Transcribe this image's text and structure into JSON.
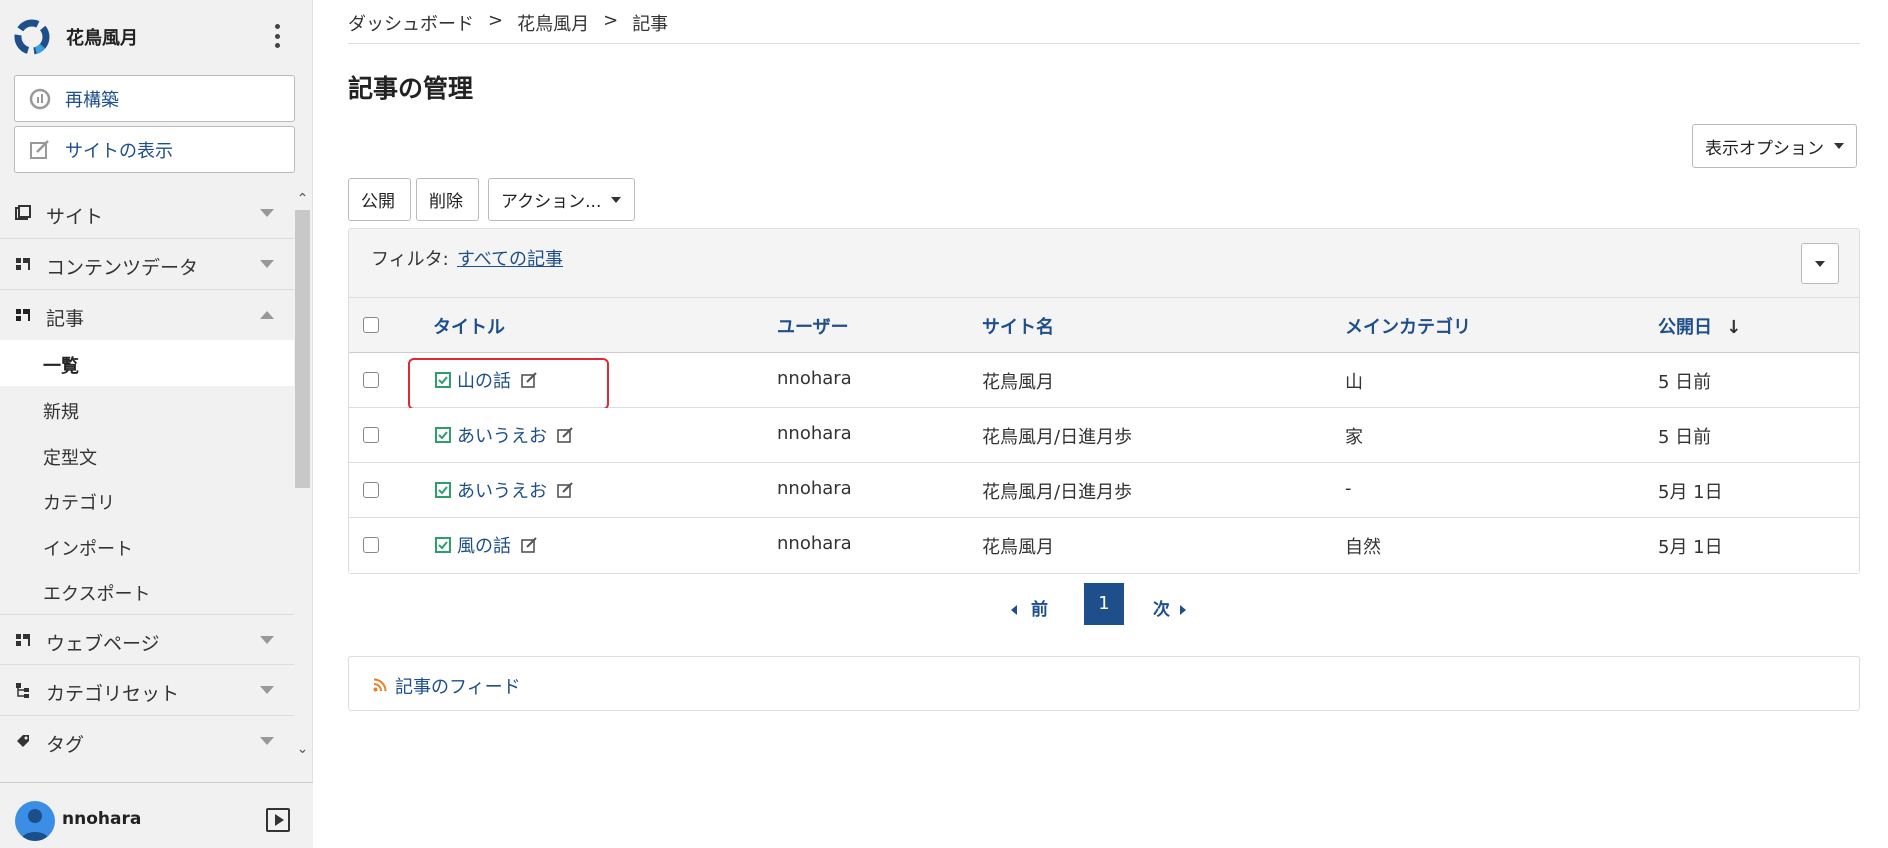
{
  "brand": {
    "name": "花鳥風月"
  },
  "sidebar": {
    "actions": [
      {
        "label": "再構築",
        "icon": "rebuild-icon"
      },
      {
        "label": "サイトの表示",
        "icon": "external-edit-icon"
      }
    ],
    "menus": [
      {
        "label": "サイト",
        "icon": "site-icon",
        "expanded": false
      },
      {
        "label": "コンテンツデータ",
        "icon": "content-data-icon",
        "expanded": false
      },
      {
        "label": "記事",
        "icon": "entry-icon",
        "expanded": true
      },
      {
        "label": "ウェブページ",
        "icon": "webpage-icon",
        "expanded": false
      },
      {
        "label": "カテゴリセット",
        "icon": "category-set-icon",
        "expanded": false
      },
      {
        "label": "タグ",
        "icon": "tag-icon",
        "expanded": false
      }
    ],
    "entry_submenu": [
      {
        "label": "一覧",
        "active": true
      },
      {
        "label": "新規",
        "active": false
      },
      {
        "label": "定型文",
        "active": false
      },
      {
        "label": "カテゴリ",
        "active": false
      },
      {
        "label": "インポート",
        "active": false
      },
      {
        "label": "エクスポート",
        "active": false
      }
    ],
    "user": {
      "name": "nnohara"
    }
  },
  "breadcrumb": [
    "ダッシュボード",
    "花鳥風月",
    "記事"
  ],
  "breadcrumb_sep": ">",
  "page": {
    "title": "記事の管理"
  },
  "display_options": "表示オプション",
  "toolbar": {
    "publish": "公開",
    "delete": "削除",
    "actions": "アクション..."
  },
  "filter": {
    "label": "フィルタ:",
    "value": "すべての記事"
  },
  "table": {
    "headers": {
      "title": "タイトル",
      "user": "ユーザー",
      "site": "サイト名",
      "category": "メインカテゴリ",
      "date": "公開日",
      "sort_indicator": "↓"
    },
    "rows": [
      {
        "title": "山の話",
        "user": "nnohara",
        "site": "花鳥風月",
        "category": "山",
        "date": "5 日前"
      },
      {
        "title": "あいうえお",
        "user": "nnohara",
        "site": "花鳥風月/日進月歩",
        "category": "家",
        "date": "5 日前"
      },
      {
        "title": "あいうえお",
        "user": "nnohara",
        "site": "花鳥風月/日進月歩",
        "category": "-",
        "date": "5月 1日"
      },
      {
        "title": "風の話",
        "user": "nnohara",
        "site": "花鳥風月",
        "category": "自然",
        "date": "5月 1日"
      }
    ]
  },
  "pager": {
    "prev": "前",
    "current": "1",
    "next": "次"
  },
  "feed": {
    "label": "記事のフィード"
  },
  "colors": {
    "link": "#1e4f8a",
    "highlight": "#e0283a",
    "status_green": "#2f9e6e",
    "feed_orange": "#e8812a"
  }
}
